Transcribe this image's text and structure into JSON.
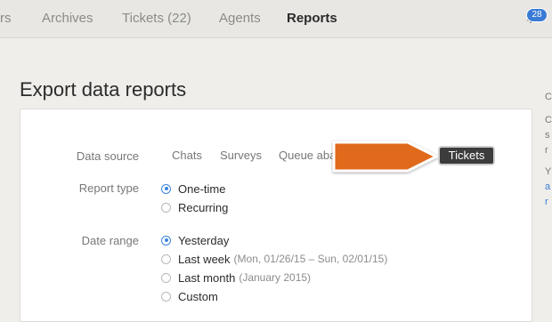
{
  "nav": {
    "items": [
      {
        "label": "rs",
        "active": false
      },
      {
        "label": "Archives",
        "active": false
      },
      {
        "label": "Tickets (22)",
        "active": false
      },
      {
        "label": "Agents",
        "active": false
      },
      {
        "label": "Reports",
        "active": true
      }
    ],
    "notification_count": "28",
    "icons": [
      "bell-icon"
    ]
  },
  "page": {
    "title": "Export data reports"
  },
  "form": {
    "data_source": {
      "label": "Data source",
      "options": [
        "Chats",
        "Surveys",
        "Queue aba",
        "Tickets"
      ],
      "selected": "Tickets"
    },
    "report_type": {
      "label": "Report type",
      "options": [
        {
          "label": "One-time",
          "checked": true
        },
        {
          "label": "Recurring",
          "checked": false
        }
      ]
    },
    "date_range": {
      "label": "Date range",
      "options": [
        {
          "label": "Yesterday",
          "hint": "",
          "checked": true
        },
        {
          "label": "Last week",
          "hint": "(Mon, 01/26/15 – Sun, 02/01/15)",
          "checked": false
        },
        {
          "label": "Last month",
          "hint": "(January 2015)",
          "checked": false
        },
        {
          "label": "Custom",
          "hint": "",
          "checked": false
        }
      ]
    }
  },
  "sidebar_fragments": [
    "C",
    "C",
    "s",
    "r",
    "Y",
    "a",
    "r"
  ],
  "colors": {
    "accent": "#3a84e0",
    "arrow": "#e0691a",
    "selected_tab_bg": "#3c3c3c"
  }
}
